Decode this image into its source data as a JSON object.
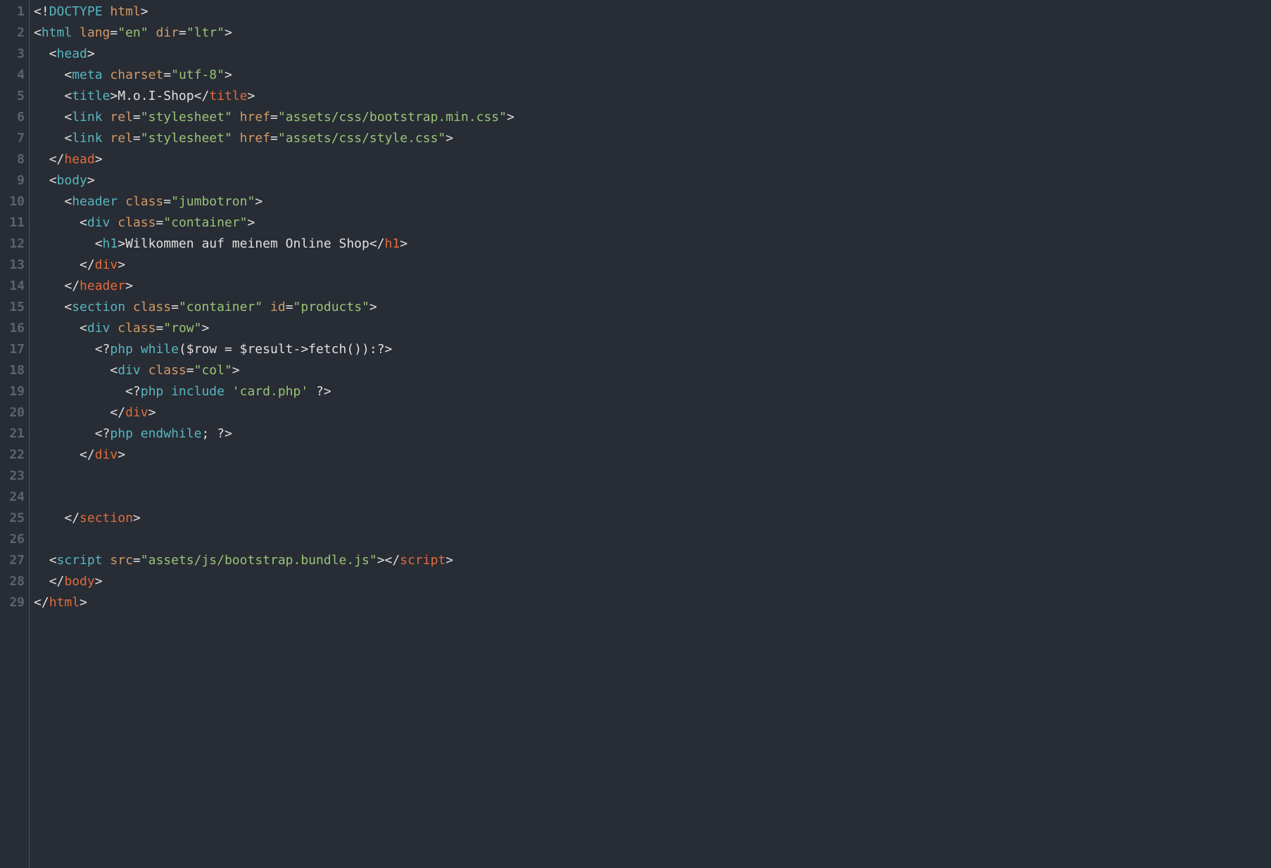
{
  "lines": [
    {
      "n": "1",
      "segments": [
        {
          "c": "punct",
          "t": "<!"
        },
        {
          "c": "tag-blue",
          "t": "DOCTYPE"
        },
        {
          "c": "text",
          "t": " "
        },
        {
          "c": "attr",
          "t": "html"
        },
        {
          "c": "punct",
          "t": ">"
        }
      ]
    },
    {
      "n": "2",
      "segments": [
        {
          "c": "punct",
          "t": "<"
        },
        {
          "c": "tag-blue",
          "t": "html"
        },
        {
          "c": "text",
          "t": " "
        },
        {
          "c": "attr",
          "t": "lang"
        },
        {
          "c": "punct",
          "t": "="
        },
        {
          "c": "string",
          "t": "\"en\""
        },
        {
          "c": "text",
          "t": " "
        },
        {
          "c": "attr",
          "t": "dir"
        },
        {
          "c": "punct",
          "t": "="
        },
        {
          "c": "string",
          "t": "\"ltr\""
        },
        {
          "c": "punct",
          "t": ">"
        }
      ]
    },
    {
      "n": "3",
      "segments": [
        {
          "c": "text",
          "t": "  "
        },
        {
          "c": "punct",
          "t": "<"
        },
        {
          "c": "tag-blue",
          "t": "head"
        },
        {
          "c": "punct",
          "t": ">"
        }
      ]
    },
    {
      "n": "4",
      "segments": [
        {
          "c": "text",
          "t": "    "
        },
        {
          "c": "punct",
          "t": "<"
        },
        {
          "c": "tag-blue",
          "t": "meta"
        },
        {
          "c": "text",
          "t": " "
        },
        {
          "c": "attr",
          "t": "charset"
        },
        {
          "c": "punct",
          "t": "="
        },
        {
          "c": "string",
          "t": "\"utf-8\""
        },
        {
          "c": "punct",
          "t": ">"
        }
      ]
    },
    {
      "n": "5",
      "segments": [
        {
          "c": "text",
          "t": "    "
        },
        {
          "c": "punct",
          "t": "<"
        },
        {
          "c": "tag-blue",
          "t": "title"
        },
        {
          "c": "punct",
          "t": ">"
        },
        {
          "c": "text",
          "t": "M.o.I-Shop"
        },
        {
          "c": "punct",
          "t": "</"
        },
        {
          "c": "tag-orange",
          "t": "title"
        },
        {
          "c": "punct",
          "t": ">"
        }
      ]
    },
    {
      "n": "6",
      "segments": [
        {
          "c": "text",
          "t": "    "
        },
        {
          "c": "punct",
          "t": "<"
        },
        {
          "c": "tag-blue",
          "t": "link"
        },
        {
          "c": "text",
          "t": " "
        },
        {
          "c": "attr",
          "t": "rel"
        },
        {
          "c": "punct",
          "t": "="
        },
        {
          "c": "string",
          "t": "\"stylesheet\""
        },
        {
          "c": "text",
          "t": " "
        },
        {
          "c": "attr",
          "t": "href"
        },
        {
          "c": "punct",
          "t": "="
        },
        {
          "c": "string",
          "t": "\"assets/css/bootstrap.min.css\""
        },
        {
          "c": "punct",
          "t": ">"
        }
      ]
    },
    {
      "n": "7",
      "segments": [
        {
          "c": "text",
          "t": "    "
        },
        {
          "c": "punct",
          "t": "<"
        },
        {
          "c": "tag-blue",
          "t": "link"
        },
        {
          "c": "text",
          "t": " "
        },
        {
          "c": "attr",
          "t": "rel"
        },
        {
          "c": "punct",
          "t": "="
        },
        {
          "c": "string",
          "t": "\"stylesheet\""
        },
        {
          "c": "text",
          "t": " "
        },
        {
          "c": "attr",
          "t": "href"
        },
        {
          "c": "punct",
          "t": "="
        },
        {
          "c": "string",
          "t": "\"assets/css/style.css\""
        },
        {
          "c": "punct",
          "t": ">"
        }
      ]
    },
    {
      "n": "8",
      "segments": [
        {
          "c": "text",
          "t": "  "
        },
        {
          "c": "punct",
          "t": "</"
        },
        {
          "c": "tag-orange",
          "t": "head"
        },
        {
          "c": "punct",
          "t": ">"
        }
      ]
    },
    {
      "n": "9",
      "segments": [
        {
          "c": "text",
          "t": "  "
        },
        {
          "c": "punct",
          "t": "<"
        },
        {
          "c": "tag-blue",
          "t": "body"
        },
        {
          "c": "punct",
          "t": ">"
        }
      ]
    },
    {
      "n": "10",
      "segments": [
        {
          "c": "text",
          "t": "    "
        },
        {
          "c": "punct",
          "t": "<"
        },
        {
          "c": "tag-blue",
          "t": "header"
        },
        {
          "c": "text",
          "t": " "
        },
        {
          "c": "attr",
          "t": "class"
        },
        {
          "c": "punct",
          "t": "="
        },
        {
          "c": "string",
          "t": "\"jumbotron\""
        },
        {
          "c": "punct",
          "t": ">"
        }
      ]
    },
    {
      "n": "11",
      "segments": [
        {
          "c": "text",
          "t": "      "
        },
        {
          "c": "punct",
          "t": "<"
        },
        {
          "c": "tag-blue",
          "t": "div"
        },
        {
          "c": "text",
          "t": " "
        },
        {
          "c": "attr",
          "t": "class"
        },
        {
          "c": "punct",
          "t": "="
        },
        {
          "c": "string",
          "t": "\"container\""
        },
        {
          "c": "punct",
          "t": ">"
        }
      ]
    },
    {
      "n": "12",
      "segments": [
        {
          "c": "text",
          "t": "        "
        },
        {
          "c": "punct",
          "t": "<"
        },
        {
          "c": "tag-blue",
          "t": "h1"
        },
        {
          "c": "punct",
          "t": ">"
        },
        {
          "c": "text",
          "t": "Wilkommen auf meinem Online Shop"
        },
        {
          "c": "punct",
          "t": "</"
        },
        {
          "c": "tag-orange",
          "t": "h1"
        },
        {
          "c": "punct",
          "t": ">"
        }
      ]
    },
    {
      "n": "13",
      "segments": [
        {
          "c": "text",
          "t": "      "
        },
        {
          "c": "punct",
          "t": "</"
        },
        {
          "c": "tag-orange",
          "t": "div"
        },
        {
          "c": "punct",
          "t": ">"
        }
      ]
    },
    {
      "n": "14",
      "segments": [
        {
          "c": "text",
          "t": "    "
        },
        {
          "c": "punct",
          "t": "</"
        },
        {
          "c": "tag-orange",
          "t": "header"
        },
        {
          "c": "punct",
          "t": ">"
        }
      ]
    },
    {
      "n": "15",
      "segments": [
        {
          "c": "text",
          "t": "    "
        },
        {
          "c": "punct",
          "t": "<"
        },
        {
          "c": "tag-blue",
          "t": "section"
        },
        {
          "c": "text",
          "t": " "
        },
        {
          "c": "attr",
          "t": "class"
        },
        {
          "c": "punct",
          "t": "="
        },
        {
          "c": "string",
          "t": "\"container\""
        },
        {
          "c": "text",
          "t": " "
        },
        {
          "c": "attr",
          "t": "id"
        },
        {
          "c": "punct",
          "t": "="
        },
        {
          "c": "string",
          "t": "\"products\""
        },
        {
          "c": "punct",
          "t": ">"
        }
      ]
    },
    {
      "n": "16",
      "segments": [
        {
          "c": "text",
          "t": "      "
        },
        {
          "c": "punct",
          "t": "<"
        },
        {
          "c": "tag-blue",
          "t": "div"
        },
        {
          "c": "text",
          "t": " "
        },
        {
          "c": "attr",
          "t": "class"
        },
        {
          "c": "punct",
          "t": "="
        },
        {
          "c": "string",
          "t": "\"row\""
        },
        {
          "c": "punct",
          "t": ">"
        }
      ]
    },
    {
      "n": "17",
      "segments": [
        {
          "c": "text",
          "t": "        "
        },
        {
          "c": "punct",
          "t": "<?"
        },
        {
          "c": "tag-blue",
          "t": "php"
        },
        {
          "c": "text",
          "t": " "
        },
        {
          "c": "keyword",
          "t": "while"
        },
        {
          "c": "text",
          "t": "($row = $result->fetch()):"
        },
        {
          "c": "punct",
          "t": "?>"
        }
      ]
    },
    {
      "n": "18",
      "segments": [
        {
          "c": "text",
          "t": "          "
        },
        {
          "c": "punct",
          "t": "<"
        },
        {
          "c": "tag-blue",
          "t": "div"
        },
        {
          "c": "text",
          "t": " "
        },
        {
          "c": "attr",
          "t": "class"
        },
        {
          "c": "punct",
          "t": "="
        },
        {
          "c": "string",
          "t": "\"col\""
        },
        {
          "c": "punct",
          "t": ">"
        }
      ]
    },
    {
      "n": "19",
      "segments": [
        {
          "c": "text",
          "t": "            "
        },
        {
          "c": "punct",
          "t": "<?"
        },
        {
          "c": "tag-blue",
          "t": "php"
        },
        {
          "c": "text",
          "t": " "
        },
        {
          "c": "keyword",
          "t": "include"
        },
        {
          "c": "text",
          "t": " "
        },
        {
          "c": "string",
          "t": "'card.php'"
        },
        {
          "c": "text",
          "t": " "
        },
        {
          "c": "punct",
          "t": "?>"
        }
      ]
    },
    {
      "n": "20",
      "segments": [
        {
          "c": "text",
          "t": "          "
        },
        {
          "c": "punct",
          "t": "</"
        },
        {
          "c": "tag-orange",
          "t": "div"
        },
        {
          "c": "punct",
          "t": ">"
        }
      ]
    },
    {
      "n": "21",
      "segments": [
        {
          "c": "text",
          "t": "        "
        },
        {
          "c": "punct",
          "t": "<?"
        },
        {
          "c": "tag-blue",
          "t": "php"
        },
        {
          "c": "text",
          "t": " "
        },
        {
          "c": "keyword",
          "t": "endwhile"
        },
        {
          "c": "text",
          "t": "; "
        },
        {
          "c": "punct",
          "t": "?>"
        }
      ]
    },
    {
      "n": "22",
      "segments": [
        {
          "c": "text",
          "t": "      "
        },
        {
          "c": "punct",
          "t": "</"
        },
        {
          "c": "tag-orange",
          "t": "div"
        },
        {
          "c": "punct",
          "t": ">"
        }
      ]
    },
    {
      "n": "23",
      "segments": []
    },
    {
      "n": "24",
      "segments": []
    },
    {
      "n": "25",
      "segments": [
        {
          "c": "text",
          "t": "    "
        },
        {
          "c": "punct",
          "t": "</"
        },
        {
          "c": "tag-orange",
          "t": "section"
        },
        {
          "c": "punct",
          "t": ">"
        }
      ]
    },
    {
      "n": "26",
      "segments": []
    },
    {
      "n": "27",
      "segments": [
        {
          "c": "text",
          "t": "  "
        },
        {
          "c": "punct",
          "t": "<"
        },
        {
          "c": "tag-blue",
          "t": "script"
        },
        {
          "c": "text",
          "t": " "
        },
        {
          "c": "attr",
          "t": "src"
        },
        {
          "c": "punct",
          "t": "="
        },
        {
          "c": "string",
          "t": "\"assets/js/bootstrap.bundle.js\""
        },
        {
          "c": "punct",
          "t": "></"
        },
        {
          "c": "tag-orange",
          "t": "script"
        },
        {
          "c": "punct",
          "t": ">"
        }
      ]
    },
    {
      "n": "28",
      "segments": [
        {
          "c": "text",
          "t": "  "
        },
        {
          "c": "punct",
          "t": "</"
        },
        {
          "c": "tag-orange",
          "t": "body"
        },
        {
          "c": "punct",
          "t": ">"
        }
      ]
    },
    {
      "n": "29",
      "segments": [
        {
          "c": "punct",
          "t": "</"
        },
        {
          "c": "tag-orange",
          "t": "html"
        },
        {
          "c": "punct",
          "t": ">"
        }
      ]
    }
  ]
}
